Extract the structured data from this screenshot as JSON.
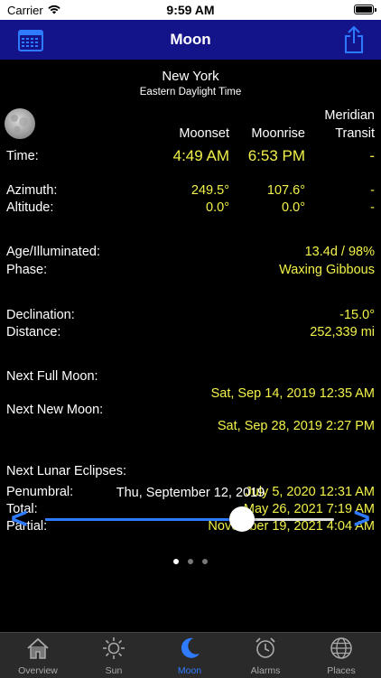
{
  "status_bar": {
    "carrier": "Carrier",
    "time": "9:59 AM"
  },
  "nav": {
    "title": "Moon"
  },
  "location": {
    "city": "New York",
    "timezone": "Eastern Daylight Time"
  },
  "table_headers": {
    "moonset": "Moonset",
    "moonrise": "Moonrise",
    "meridian_line1": "Meridian",
    "meridian_line2": "Transit"
  },
  "time_row": {
    "label": "Time:",
    "moonset": "4:49 AM",
    "moonrise": "6:53 PM",
    "transit": "-"
  },
  "azimuth_row": {
    "label": "Azimuth:",
    "moonset": "249.5°",
    "moonrise": "107.6°",
    "transit": "-"
  },
  "altitude_row": {
    "label": "Altitude:",
    "moonset": "0.0°",
    "moonrise": "0.0°",
    "transit": "-"
  },
  "age": {
    "label": "Age/Illuminated:",
    "value": "13.4d / 98%"
  },
  "phase": {
    "label": "Phase:",
    "value": "Waxing Gibbous"
  },
  "declination": {
    "label": "Declination:",
    "value": "-15.0°"
  },
  "distance": {
    "label": "Distance:",
    "value": "252,339 mi"
  },
  "next_full": {
    "label": "Next Full Moon:",
    "value": "Sat, Sep 14, 2019 12:35 AM"
  },
  "next_new": {
    "label": "Next New Moon:",
    "value": "Sat, Sep 28, 2019 2:27 PM"
  },
  "eclipses": {
    "label": "Next Lunar Eclipses:",
    "penumbral_label": "Penumbral:",
    "penumbral_value": "July 5, 2020 12:31 AM",
    "total_label": "Total:",
    "total_value": "May 26, 2021 7:19 AM",
    "partial_label": "Partial:",
    "partial_value": "November 19, 2021 4:04 AM"
  },
  "date_slider": {
    "date": "Thu, September 12, 2019",
    "prev": "<",
    "next": ">",
    "position": 0.68
  },
  "page_dots": {
    "count": 3,
    "active": 0
  },
  "tabs": [
    {
      "label": "Overview",
      "icon": "house-icon"
    },
    {
      "label": "Sun",
      "icon": "sun-icon"
    },
    {
      "label": "Moon",
      "icon": "moon-icon"
    },
    {
      "label": "Alarms",
      "icon": "alarm-clock-icon"
    },
    {
      "label": "Places",
      "icon": "globe-icon"
    }
  ],
  "colors": {
    "nav_bg": "#13138a",
    "accent": "#2f7bff",
    "value": "#f2f24a"
  }
}
